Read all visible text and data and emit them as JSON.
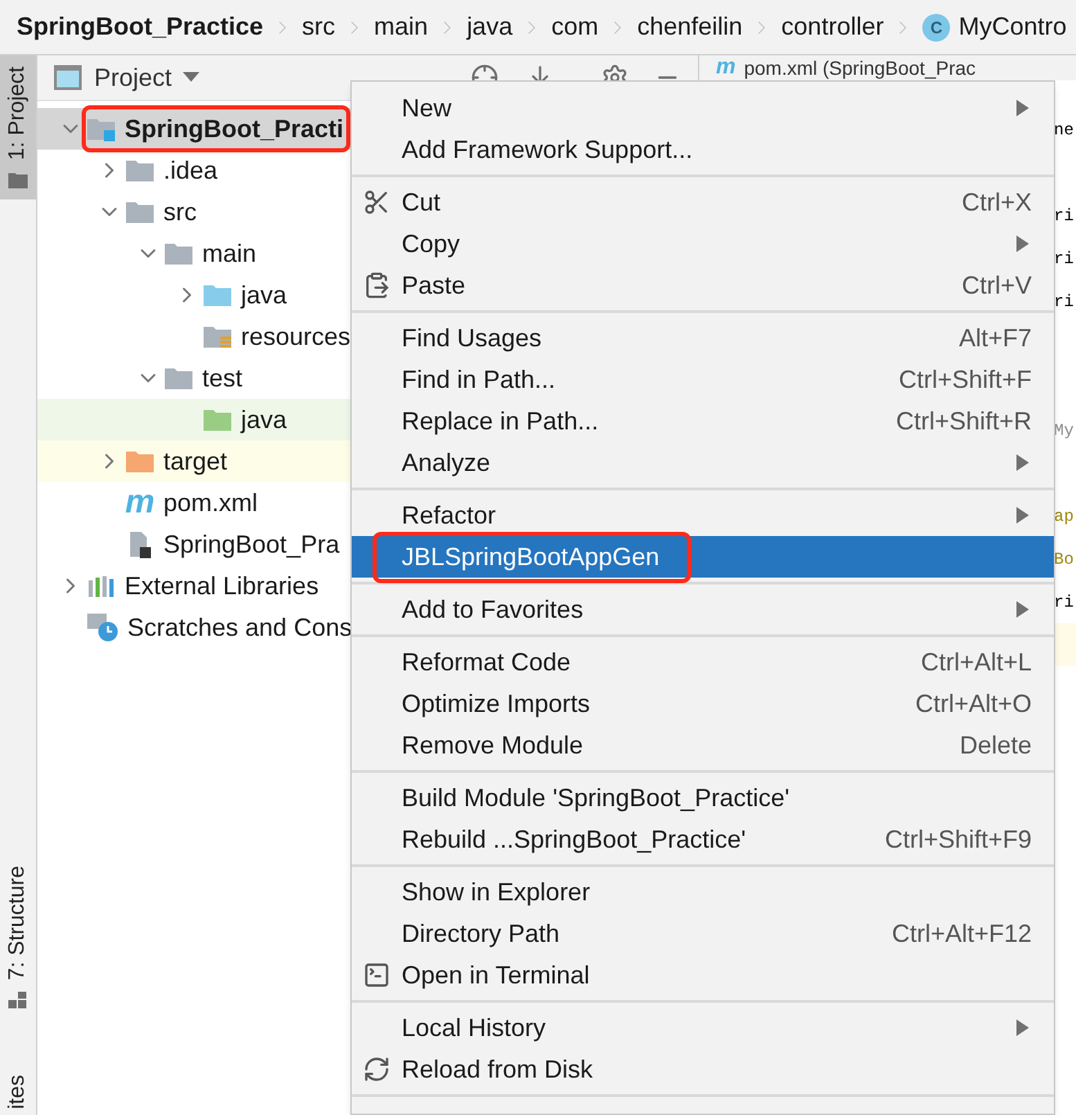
{
  "breadcrumb": [
    {
      "label": "SpringBoot_Practice",
      "kind": "project"
    },
    {
      "label": "src",
      "kind": "dir"
    },
    {
      "label": "main",
      "kind": "dir"
    },
    {
      "label": "java",
      "kind": "dir"
    },
    {
      "label": "com",
      "kind": "dir"
    },
    {
      "label": "chenfeilin",
      "kind": "dir"
    },
    {
      "label": "controller",
      "kind": "dir"
    },
    {
      "label": "MyContro",
      "kind": "class",
      "glyph": "C"
    }
  ],
  "tool_strip": {
    "top": [
      {
        "label": "1: Project",
        "selected": true
      }
    ],
    "bottom": [
      {
        "label": "7: Structure",
        "selected": false
      },
      {
        "label": "ites",
        "selected": false
      }
    ]
  },
  "project_panel": {
    "title": "Project",
    "tree": [
      {
        "label": "SpringBoot_Practi",
        "kind": "module",
        "expanded": true,
        "selected": true,
        "outlined": true,
        "children": [
          {
            "label": ".idea",
            "kind": "folder",
            "expanded": false,
            "selected": false
          },
          {
            "label": "src",
            "kind": "folder",
            "expanded": true,
            "selected": false,
            "children": [
              {
                "label": "main",
                "kind": "folder",
                "expanded": true,
                "selected": false,
                "children": [
                  {
                    "label": "java",
                    "kind": "source",
                    "expanded": false,
                    "selected": false
                  },
                  {
                    "label": "resources",
                    "kind": "resources",
                    "selected": false
                  }
                ]
              },
              {
                "label": "test",
                "kind": "folder",
                "expanded": true,
                "selected": false,
                "children": [
                  {
                    "label": "java",
                    "kind": "test",
                    "selected": false
                  }
                ]
              }
            ]
          },
          {
            "label": "target",
            "kind": "excluded",
            "expanded": false,
            "selected": false
          },
          {
            "label": "pom.xml",
            "kind": "maven",
            "glyph": "m",
            "selected": false
          },
          {
            "label": "SpringBoot_Pra",
            "kind": "iml",
            "selected": false
          }
        ]
      },
      {
        "label": "External Libraries",
        "kind": "library",
        "expanded": false,
        "selected": false
      },
      {
        "label": "Scratches and Cons",
        "kind": "scratch",
        "selected": false
      }
    ]
  },
  "editor": {
    "tab": {
      "label": "pom.xml (SpringBoot_Prac",
      "glyph": "m"
    },
    "lines": [
      {
        "kind": "code",
        "text": "ne"
      },
      {
        "kind": "blank"
      },
      {
        "kind": "code",
        "text": "ri"
      },
      {
        "kind": "code",
        "text": "ri"
      },
      {
        "kind": "code",
        "text": "ri"
      },
      {
        "kind": "blank"
      },
      {
        "kind": "blank"
      },
      {
        "kind": "comment",
        "text": "My"
      },
      {
        "kind": "blank"
      },
      {
        "kind": "annotation",
        "text": "ap"
      },
      {
        "kind": "annotation",
        "text": "Bo"
      },
      {
        "kind": "code",
        "text": "ri"
      },
      {
        "kind": "current"
      }
    ]
  },
  "context_menu": {
    "groups": [
      [
        {
          "label": "New",
          "submenu": true,
          "selected": false
        },
        {
          "label": "Add Framework Support...",
          "selected": false
        }
      ],
      [
        {
          "label": "Cut",
          "kind": "cut",
          "shortcut": "Ctrl+X",
          "selected": false
        },
        {
          "label": "Copy",
          "submenu": true,
          "selected": false
        },
        {
          "label": "Paste",
          "kind": "paste",
          "shortcut": "Ctrl+V",
          "selected": false
        }
      ],
      [
        {
          "label": "Find Usages",
          "shortcut": "Alt+F7",
          "selected": false
        },
        {
          "label": "Find in Path...",
          "shortcut": "Ctrl+Shift+F",
          "selected": false
        },
        {
          "label": "Replace in Path...",
          "shortcut": "Ctrl+Shift+R",
          "selected": false
        },
        {
          "label": "Analyze",
          "submenu": true,
          "selected": false
        }
      ],
      [
        {
          "label": "Refactor",
          "submenu": true,
          "selected": false
        },
        {
          "label": "JBLSpringBootAppGen",
          "selected": true,
          "outlined": true
        }
      ],
      [
        {
          "label": "Add to Favorites",
          "submenu": true,
          "selected": false
        }
      ],
      [
        {
          "label": "Reformat Code",
          "shortcut": "Ctrl+Alt+L",
          "selected": false
        },
        {
          "label": "Optimize Imports",
          "shortcut": "Ctrl+Alt+O",
          "selected": false
        },
        {
          "label": "Remove Module",
          "shortcut": "Delete",
          "selected": false
        }
      ],
      [
        {
          "label": "Build Module 'SpringBoot_Practice'",
          "selected": false
        },
        {
          "label": "Rebuild ...SpringBoot_Practice'",
          "shortcut": "Ctrl+Shift+F9",
          "selected": false
        }
      ],
      [
        {
          "label": "Show in Explorer",
          "selected": false
        },
        {
          "label": "Directory Path",
          "shortcut": "Ctrl+Alt+F12",
          "selected": false
        },
        {
          "label": "Open in Terminal",
          "kind": "terminal",
          "selected": false
        }
      ],
      [
        {
          "label": "Local History",
          "submenu": true,
          "selected": false
        },
        {
          "label": "Reload from Disk",
          "kind": "reload",
          "selected": false
        }
      ]
    ]
  }
}
